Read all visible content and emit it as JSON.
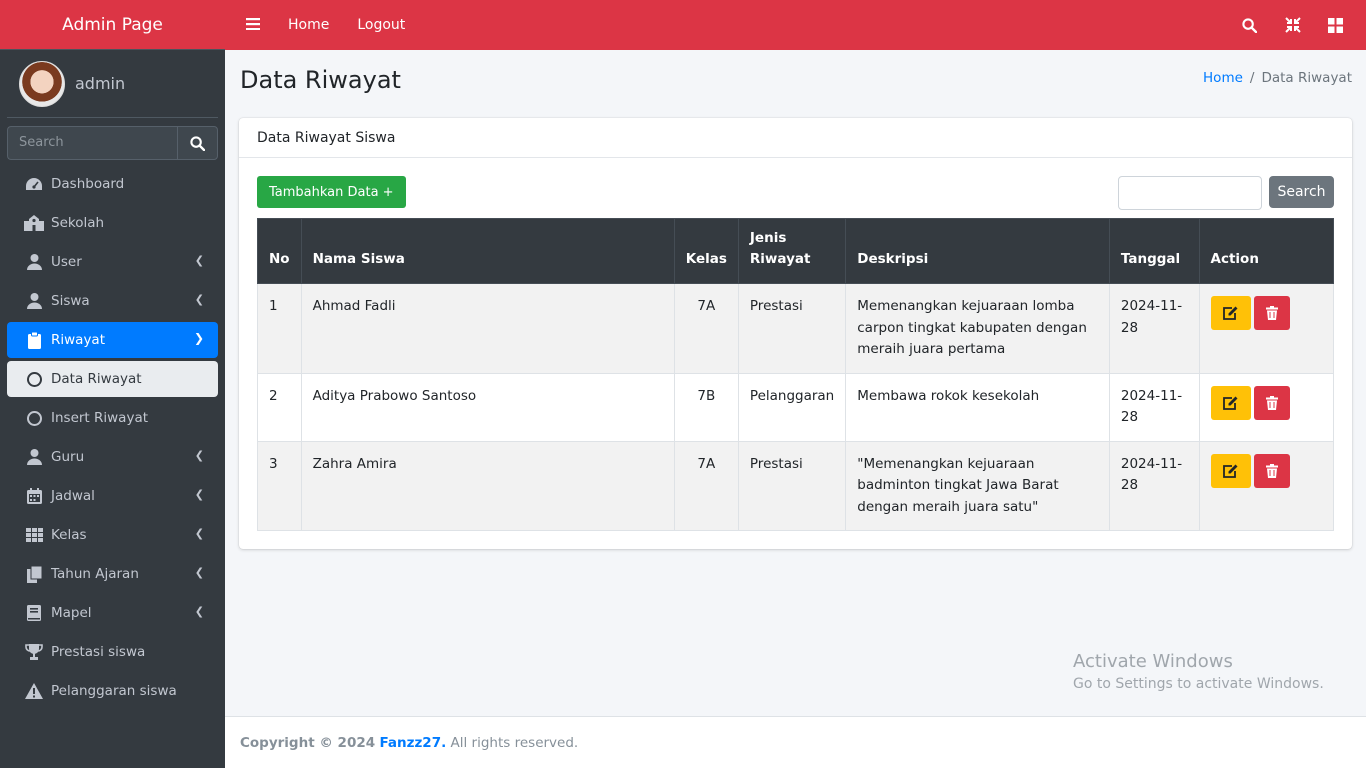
{
  "brand": "Admin Page",
  "user": {
    "name": "admin"
  },
  "sidebar_search": {
    "placeholder": "Search"
  },
  "nav": [
    {
      "label": "Dashboard",
      "icon": "dashboard-icon"
    },
    {
      "label": "Sekolah",
      "icon": "school-icon"
    },
    {
      "label": "User",
      "icon": "user-icon"
    },
    {
      "label": "Siswa",
      "icon": "user-icon"
    },
    {
      "label": "Riwayat",
      "icon": "clipboard-icon"
    },
    {
      "label": "Data Riwayat",
      "icon": "circle-icon"
    },
    {
      "label": "Insert Riwayat",
      "icon": "circle-icon"
    },
    {
      "label": "Guru",
      "icon": "user-icon"
    },
    {
      "label": "Jadwal",
      "icon": "calendar-icon"
    },
    {
      "label": "Kelas",
      "icon": "grid-icon"
    },
    {
      "label": "Tahun Ajaran",
      "icon": "copy-icon"
    },
    {
      "label": "Mapel",
      "icon": "book-icon"
    },
    {
      "label": "Prestasi siswa",
      "icon": "trophy-icon"
    },
    {
      "label": "Pelanggaran siswa",
      "icon": "warning-icon"
    }
  ],
  "topbar": {
    "home": "Home",
    "logout": "Logout"
  },
  "page": {
    "title": "Data Riwayat"
  },
  "breadcrumb": {
    "home": "Home",
    "sep": "/",
    "current": "Data Riwayat"
  },
  "card": {
    "title": "Data Riwayat Siswa",
    "add_button": "Tambahkan Data +",
    "search_button": "Search"
  },
  "table": {
    "headers": {
      "no": "No",
      "nama": "Nama Siswa",
      "kelas": "Kelas",
      "jenis_1": "Jenis",
      "jenis_2": "Riwayat",
      "deskripsi": "Deskripsi",
      "tanggal": "Tanggal",
      "action": "Action"
    },
    "rows": [
      {
        "no": "1",
        "nama": "Ahmad Fadli",
        "kelas": "7A",
        "jenis": "Prestasi",
        "deskripsi": "Memenangkan kejuaraan lomba carpon tingkat kabupaten dengan meraih juara pertama",
        "tanggal": "2024-11-28"
      },
      {
        "no": "2",
        "nama": "Aditya Prabowo Santoso",
        "kelas": "7B",
        "jenis": "Pelanggaran",
        "deskripsi": "Membawa rokok kesekolah",
        "tanggal": "2024-11-28"
      },
      {
        "no": "3",
        "nama": "Zahra Amira",
        "kelas": "7A",
        "jenis": "Prestasi",
        "deskripsi": "\"Memenangkan kejuaraan badminton tingkat Jawa Barat dengan meraih juara satu\"",
        "tanggal": "2024-11-28"
      }
    ]
  },
  "watermark": {
    "line1": "Activate Windows",
    "line2": "Go to Settings to activate Windows."
  },
  "footer": {
    "copyright": "Copyright © 2024",
    "brand": "Fanzz27.",
    "rights": "All rights reserved."
  },
  "colors": {
    "topbar": "#dc3545",
    "sidebar": "#343a40",
    "active": "#007bff",
    "add": "#28a745",
    "edit": "#ffc107",
    "delete": "#dc3545"
  }
}
